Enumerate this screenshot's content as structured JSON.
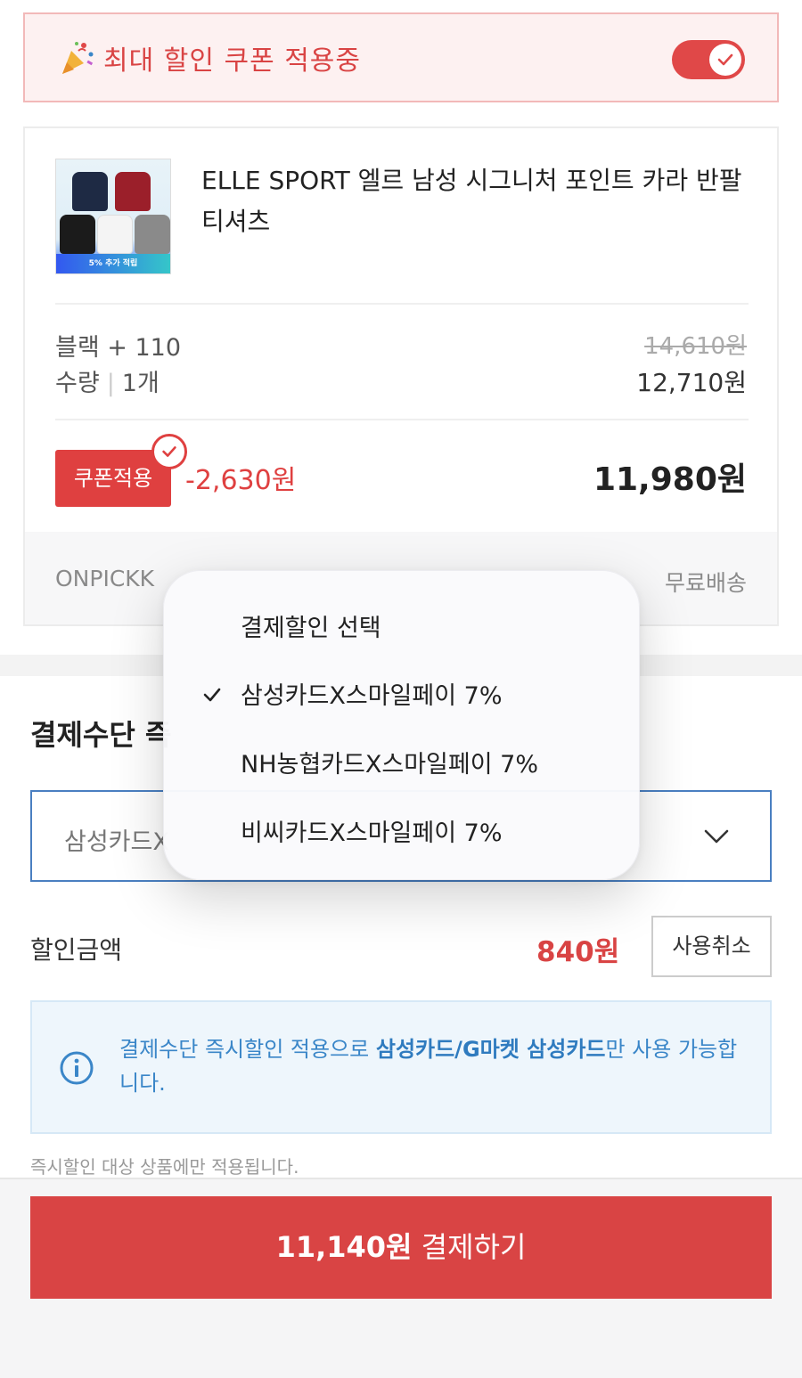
{
  "coupon_banner": {
    "title": "최대 할인 쿠폰 적용중",
    "toggle_on": true
  },
  "product": {
    "name": "ELLE SPORT 엘르 남성 시그니처 포인트 카라 반팔 티셔츠",
    "thumbnail_badge": "5% 추가 적립",
    "option": "블랙 + 110",
    "qty_label": "수량",
    "qty_value": "1개",
    "original_price": "14,610원",
    "sale_price": "12,710원",
    "coupon_button": "쿠폰적용",
    "coupon_discount": "-2,630원",
    "final_price": "11,980원",
    "seller": "ONPICKK",
    "shipping": "무료배송"
  },
  "payment": {
    "section_title": "결제수단 즉",
    "selected_method": "삼성카드X",
    "discount_label": "할인금액",
    "discount_amount": "840원",
    "cancel_button": "사용취소",
    "notice_pre": "결제수단 즉시할인 적용으로 ",
    "notice_bold": "삼성카드/G마켓 삼성카드",
    "notice_post": "만 사용 가능합니다.",
    "small_note": "즉시할인 대상 상품에만 적용됩니다."
  },
  "dropdown": {
    "header": "결제할인 선택",
    "options": [
      {
        "label": "삼성카드X스마일페이 7%",
        "selected": true
      },
      {
        "label": "NH농협카드X스마일페이 7%",
        "selected": false
      },
      {
        "label": "비씨카드X스마일페이 7%",
        "selected": false
      }
    ]
  },
  "checkout": {
    "amount": "11,140원",
    "action": " 결제하기"
  },
  "colors": {
    "accent_red": "#df4040",
    "info_blue": "#3a86c8",
    "select_border": "#4a7fc1"
  }
}
